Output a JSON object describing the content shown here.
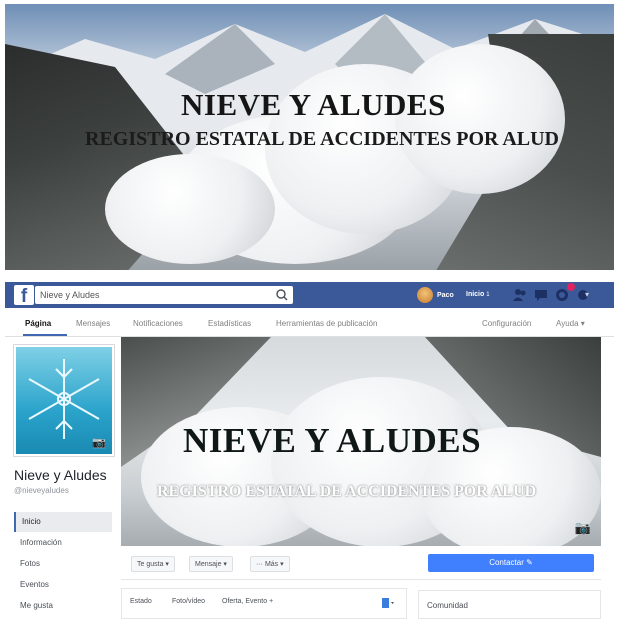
{
  "banner": {
    "title": "NIEVE Y ALUDES",
    "subtitle": "REGISTRO ESTATAL DE ACCIDENTES POR ALUD"
  },
  "topbar": {
    "logo": "f",
    "search_value": "Nieve y Aludes",
    "search_icon": "search-icon",
    "user_name": "Paco",
    "home_label": "Inicio",
    "home_count": "1",
    "icons": [
      "friend-requests-icon",
      "messages-icon",
      "notifications-icon",
      "help-icon"
    ],
    "colors": {
      "bar": "#3b5998",
      "accent": "#4080ff"
    }
  },
  "tabs": [
    "Página",
    "Mensajes",
    "Notificaciones",
    "Estadísticas",
    "Herramientas de publicación",
    "Configuración",
    "Ayuda ▾"
  ],
  "sidebar": {
    "page_name": "Nieve y Aludes",
    "page_handle": "@nieveyaludes",
    "items": [
      "Inicio",
      "Información",
      "Fotos",
      "Eventos",
      "Me gusta"
    ]
  },
  "cover": {
    "title": "NIEVE Y ALUDES",
    "subtitle": "REGISTRO ESTATAL DE ACCIDENTES POR ALUD"
  },
  "actions": {
    "like": "Te gusta ▾",
    "message": "Mensaje ▾",
    "more": "··· Más ▾",
    "contact": "Contactar ✎"
  },
  "composer": {
    "status": "Estado",
    "photo": "Foto/vídeo",
    "offer": "Oferta, Evento +"
  },
  "community": {
    "label": "Comunidad"
  }
}
